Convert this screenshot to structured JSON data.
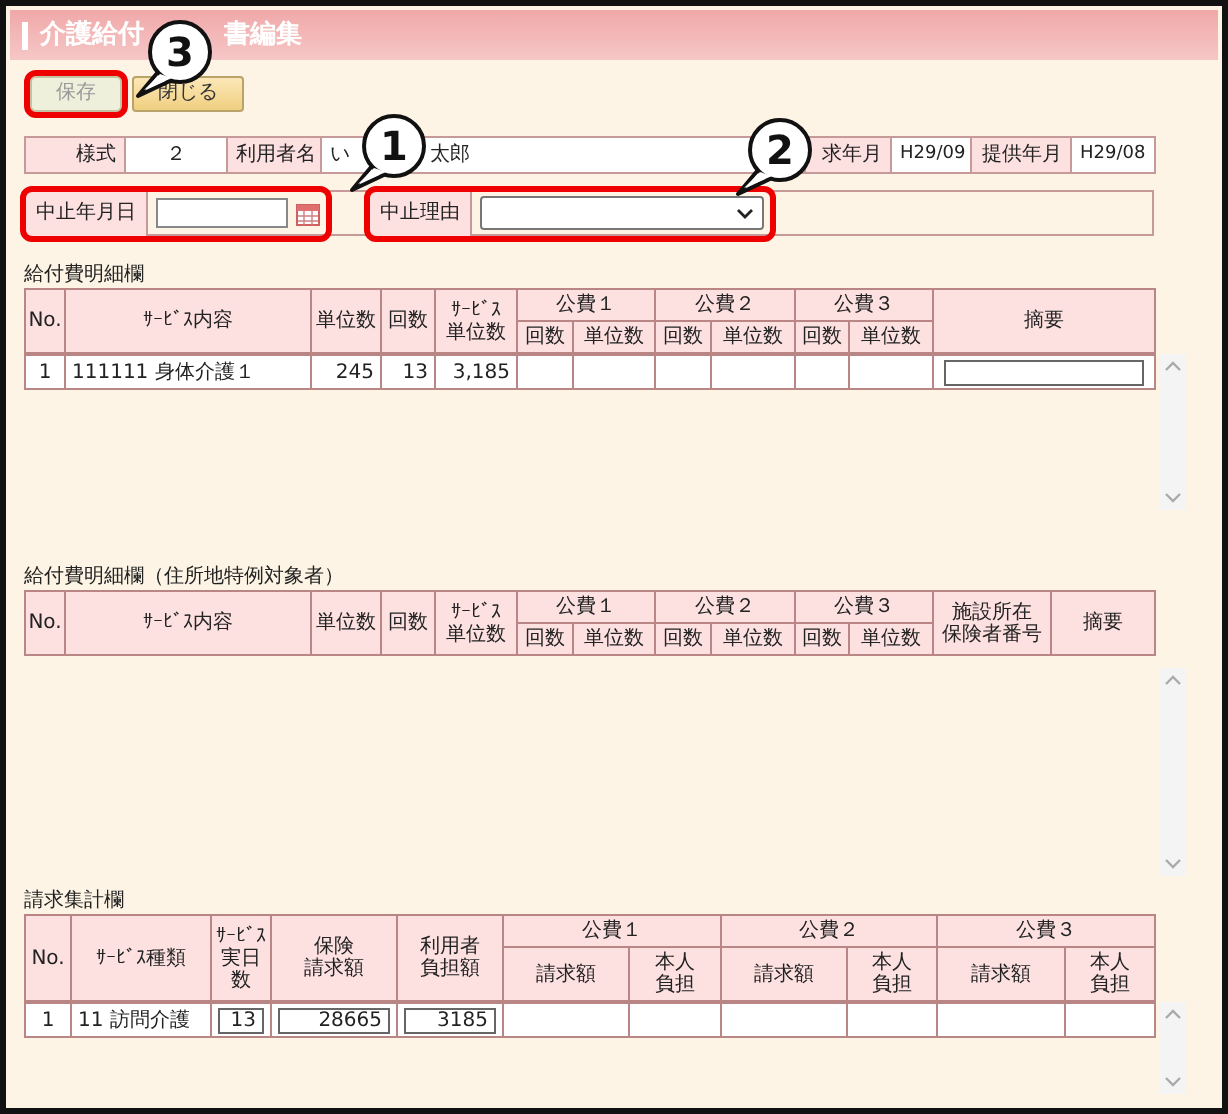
{
  "window": {
    "title_parts": [
      "介護給付",
      "書編集"
    ]
  },
  "buttons": [
    {
      "label": "保存",
      "disabled": true,
      "highlighted": true
    },
    {
      "label": "閉じる",
      "disabled": false,
      "highlighted": false
    }
  ],
  "info": [
    {
      "label": "様式",
      "value_parts": [
        "２"
      ]
    },
    {
      "label": "利用者名",
      "value_parts": [
        "い",
        "太郎"
      ]
    },
    {
      "label": "求年月",
      "value_parts": [
        "H29/09"
      ]
    },
    {
      "label": "提供年月",
      "value_parts": [
        "H29/08"
      ]
    }
  ],
  "stop_fields": [
    {
      "kind": "date",
      "label": "中止年月日",
      "highlighted": true
    },
    {
      "kind": "select",
      "label": "中止理由",
      "highlighted": true
    }
  ],
  "callouts": [
    {
      "number": "1"
    },
    {
      "number": "2"
    },
    {
      "number": "3"
    }
  ],
  "sections": [
    {
      "kind": "detail",
      "title": "給付費明細欄",
      "columns": [
        {
          "lines": [
            "No."
          ]
        },
        {
          "lines": [
            "ｻｰﾋﾞｽ内容"
          ]
        },
        {
          "lines": [
            "単位数"
          ]
        },
        {
          "lines": [
            "回数"
          ]
        },
        {
          "lines": [
            "ｻｰﾋﾞｽ",
            "単位数"
          ]
        },
        {
          "lines": [
            "公費１"
          ],
          "children": [
            {
              "lines": [
                "回数"
              ]
            },
            {
              "lines": [
                "単位数"
              ]
            }
          ]
        },
        {
          "lines": [
            "公費２"
          ],
          "children": [
            {
              "lines": [
                "回数"
              ]
            },
            {
              "lines": [
                "単位数"
              ]
            }
          ]
        },
        {
          "lines": [
            "公費３"
          ],
          "children": [
            {
              "lines": [
                "回数"
              ]
            },
            {
              "lines": [
                "単位数"
              ]
            }
          ]
        },
        {
          "lines": [
            "摘要"
          ]
        }
      ],
      "rows": [
        {
          "cells": [
            {
              "kind": "index",
              "text": "1"
            },
            {
              "kind": "text",
              "text": "111111 身体介護１"
            },
            {
              "kind": "number",
              "text": "245"
            },
            {
              "kind": "number",
              "text": "13"
            },
            {
              "kind": "number",
              "text": "3,185"
            },
            {
              "kind": "empty"
            },
            {
              "kind": "empty"
            },
            {
              "kind": "empty"
            },
            {
              "kind": "empty"
            },
            {
              "kind": "empty"
            },
            {
              "kind": "empty"
            },
            {
              "kind": "input"
            }
          ]
        }
      ]
    },
    {
      "kind": "special",
      "title": "給付費明細欄（住所地特例対象者）",
      "columns": [
        {
          "lines": [
            "No."
          ]
        },
        {
          "lines": [
            "ｻｰﾋﾞｽ内容"
          ]
        },
        {
          "lines": [
            "単位数"
          ]
        },
        {
          "lines": [
            "回数"
          ]
        },
        {
          "lines": [
            "ｻｰﾋﾞｽ",
            "単位数"
          ]
        },
        {
          "lines": [
            "公費１"
          ],
          "children": [
            {
              "lines": [
                "回数"
              ]
            },
            {
              "lines": [
                "単位数"
              ]
            }
          ]
        },
        {
          "lines": [
            "公費２"
          ],
          "children": [
            {
              "lines": [
                "回数"
              ]
            },
            {
              "lines": [
                "単位数"
              ]
            }
          ]
        },
        {
          "lines": [
            "公費３"
          ],
          "children": [
            {
              "lines": [
                "回数"
              ]
            },
            {
              "lines": [
                "単位数"
              ]
            }
          ]
        },
        {
          "lines": [
            "施設所在",
            "保険者番号"
          ]
        },
        {
          "lines": [
            "摘要"
          ]
        }
      ]
    },
    {
      "kind": "summary",
      "title": "請求集計欄",
      "columns": [
        {
          "lines": [
            "No."
          ]
        },
        {
          "lines": [
            "ｻｰﾋﾞｽ種類"
          ]
        },
        {
          "lines": [
            "ｻｰﾋﾞｽ",
            "実日",
            "数"
          ]
        },
        {
          "lines": [
            "保険",
            "請求額"
          ]
        },
        {
          "lines": [
            "利用者",
            "負担額"
          ]
        },
        {
          "lines": [
            "公費１"
          ],
          "children": [
            {
              "lines": [
                "請求額"
              ]
            },
            {
              "lines": [
                "本人",
                "負担"
              ]
            }
          ]
        },
        {
          "lines": [
            "公費２"
          ],
          "children": [
            {
              "lines": [
                "請求額"
              ]
            },
            {
              "lines": [
                "本人",
                "負担"
              ]
            }
          ]
        },
        {
          "lines": [
            "公費３"
          ],
          "children": [
            {
              "lines": [
                "請求額"
              ]
            },
            {
              "lines": [
                "本人",
                "負担"
              ]
            }
          ]
        }
      ],
      "rows": [
        {
          "cells": [
            {
              "kind": "index",
              "text": "1"
            },
            {
              "kind": "text",
              "text": "11 訪問介護"
            },
            {
              "kind": "input",
              "value": "13"
            },
            {
              "kind": "input",
              "value": "28665"
            },
            {
              "kind": "input",
              "value": "3185"
            },
            {
              "kind": "empty"
            },
            {
              "kind": "empty"
            },
            {
              "kind": "empty"
            },
            {
              "kind": "empty"
            },
            {
              "kind": "empty"
            },
            {
              "kind": "empty"
            }
          ]
        }
      ]
    }
  ]
}
